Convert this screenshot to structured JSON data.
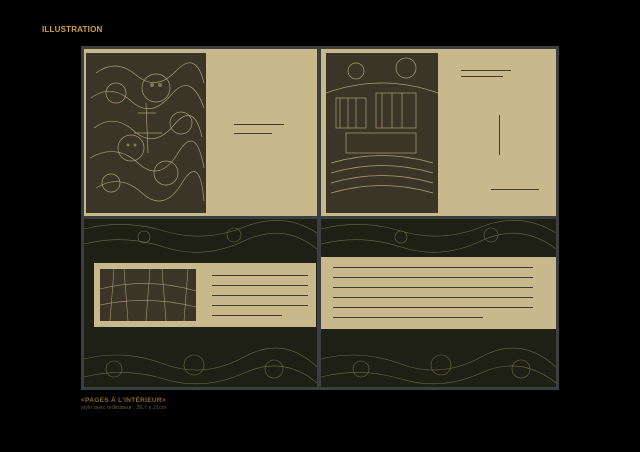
{
  "section_heading": "ILLUSTRATION",
  "caption": {
    "title": "<PAGES À L’INTÉRIEUR>",
    "subtitle": "stylo avec ordinateur  ,  26,7 x 21cm"
  },
  "colors": {
    "background": "#000000",
    "heading": "#c9a24a",
    "paper": "#c8b98d",
    "ink": "#2a2418",
    "board": "#3c3f40",
    "dark_pattern": "#1e2016"
  },
  "spreads": [
    {
      "name": "spread-1-left-page"
    },
    {
      "name": "spread-1-right-page"
    },
    {
      "name": "spread-2-left-page"
    },
    {
      "name": "spread-2-right-page"
    }
  ]
}
